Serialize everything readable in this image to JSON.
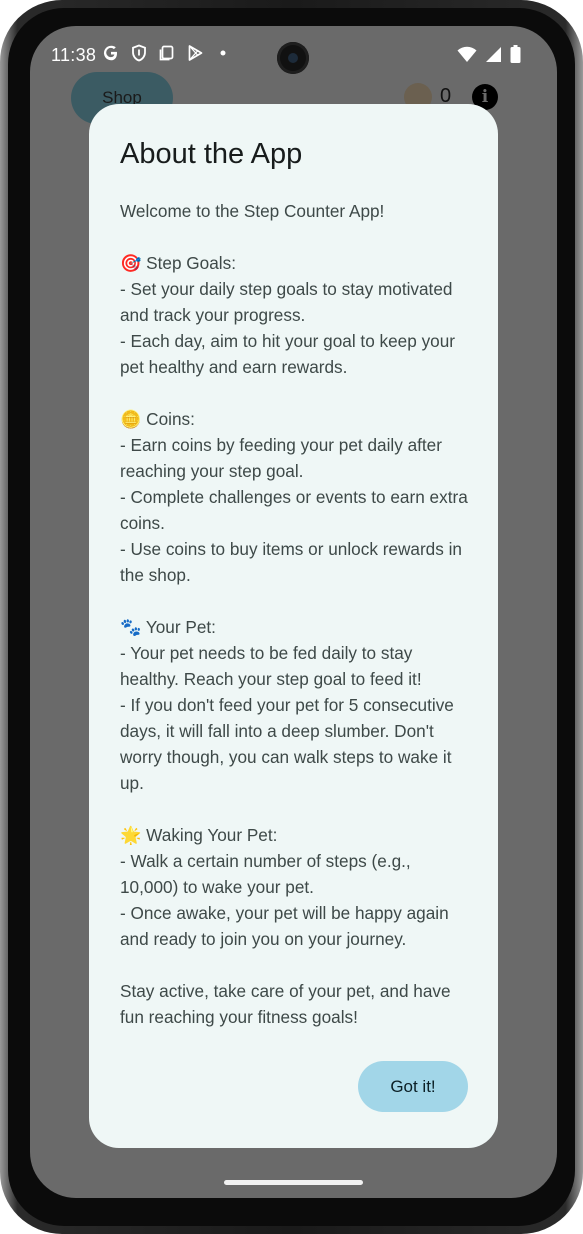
{
  "status_bar": {
    "time": "11:38",
    "icons": [
      "google-icon",
      "shield-icon",
      "clipboard-icon",
      "play-store-icon",
      "dot-icon"
    ],
    "right_icons": [
      "wifi-icon",
      "signal-icon",
      "battery-icon"
    ]
  },
  "app_header": {
    "shop_label": "Shop",
    "coin_count": "0"
  },
  "dialog": {
    "title": "About the App",
    "body": "Welcome to the Step Counter App!\n\n🎯 Step Goals:\n- Set your daily step goals to stay motivated and track your progress.\n- Each day, aim to hit your goal to keep your pet healthy and earn rewards.\n\n🪙 Coins:\n- Earn coins by feeding your pet daily after reaching your step goal.\n- Complete challenges or events to earn extra coins.\n- Use coins to buy items or unlock rewards in the shop.\n\n🐾 Your Pet:\n- Your pet needs to be fed daily to stay healthy. Reach your step goal to feed it!\n- If you don't feed your pet for 5 consecutive days, it will fall into a deep slumber. Don't worry though, you can walk steps to wake it up.\n\n🌟 Waking Your Pet:\n- Walk a certain number of steps (e.g., 10,000) to wake your pet.\n- Once awake, your pet will be happy again and ready to join you on your journey.\n\nStay active, take care of your pet, and have fun reaching your fitness goals!",
    "confirm_label": "Got it!"
  },
  "colors": {
    "scrim": "#6a6a6a",
    "dialog_bg": "#eff7f6",
    "confirm_button": "#a2d6e8"
  }
}
